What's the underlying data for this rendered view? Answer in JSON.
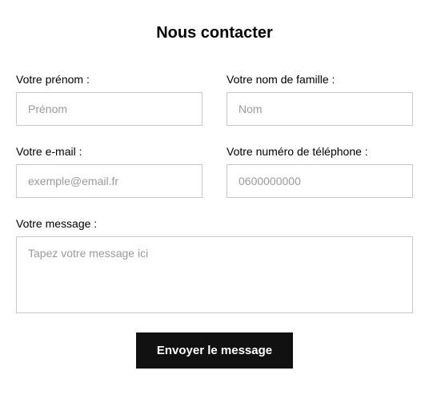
{
  "title": "Nous contacter",
  "fields": {
    "firstName": {
      "label": "Votre prénom :",
      "placeholder": "Prénom"
    },
    "lastName": {
      "label": "Votre nom de famille :",
      "placeholder": "Nom"
    },
    "email": {
      "label": "Votre e-mail :",
      "placeholder": "exemple@email.fr"
    },
    "phone": {
      "label": "Votre numéro de téléphone :",
      "placeholder": "0600000000"
    },
    "message": {
      "label": "Votre message :",
      "placeholder": "Tapez votre message ici"
    }
  },
  "submitLabel": "Envoyer le message"
}
